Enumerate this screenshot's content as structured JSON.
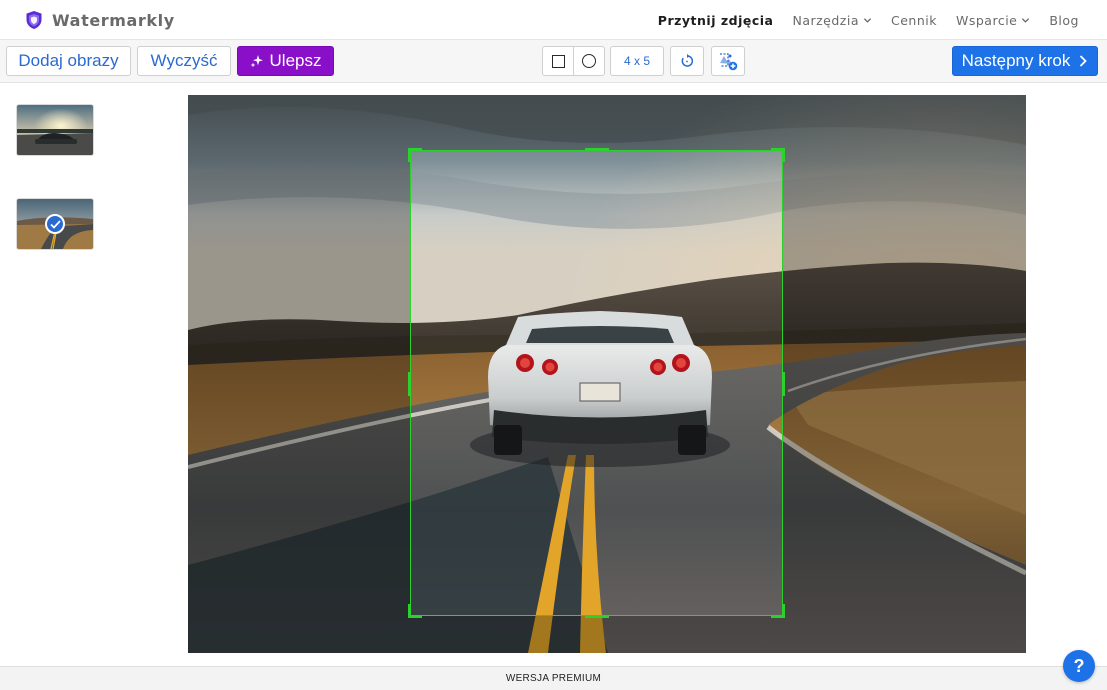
{
  "app": {
    "name": "Watermarkly",
    "brand_color": "#5b2bd3"
  },
  "nav": {
    "items": [
      {
        "label": "Przytnij zdjęcia",
        "active": true,
        "dropdown": false
      },
      {
        "label": "Narzędzia",
        "active": false,
        "dropdown": true
      },
      {
        "label": "Cennik",
        "active": false,
        "dropdown": false
      },
      {
        "label": "Wsparcie",
        "active": false,
        "dropdown": true
      },
      {
        "label": "Blog",
        "active": false,
        "dropdown": false
      }
    ]
  },
  "toolbar": {
    "add_label": "Dodaj obrazy",
    "clear_label": "Wyczyść",
    "enhance_label": "Ulepsz",
    "ratio_label": "4 x 5",
    "next_label": "Następny krok",
    "shape_options": [
      "square-icon",
      "circle-icon"
    ],
    "selected_shape": "square",
    "accent_color": "#1e72e8",
    "enhance_color": "#8a0fc9",
    "crop_color": "#2bd22b"
  },
  "sidebar": {
    "thumbnails": [
      {
        "image": "car-sunset-thumbnail",
        "selected": false
      },
      {
        "image": "car-road-thumbnail",
        "selected": true
      }
    ]
  },
  "footer": {
    "label": "WERSJA PREMIUM",
    "help_label": "?"
  }
}
